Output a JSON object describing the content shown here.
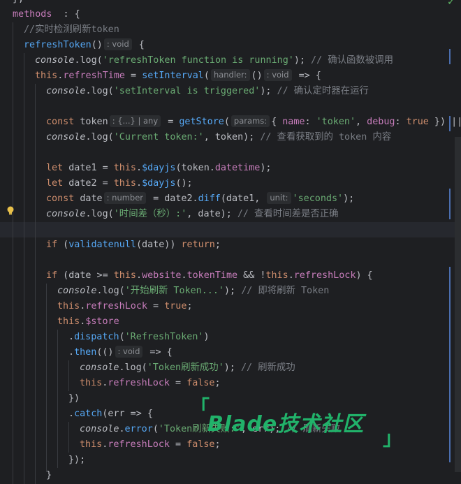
{
  "watermark": {
    "open": "「",
    "text": "Blade技术社区",
    "close": "」"
  },
  "top_fragment": "},",
  "lines": [
    {
      "tokens": [
        [
          "prop",
          "methods"
        ],
        [
          "",
          "  : {"
        ]
      ]
    },
    {
      "tokens": [
        [
          "cm",
          "//实时检测刷新token"
        ]
      ]
    },
    {
      "tokens": [
        [
          "fn",
          "refreshToken"
        ],
        [
          "",
          "()"
        ],
        [
          "hint",
          ": void"
        ],
        [
          "",
          " {"
        ]
      ]
    },
    {
      "tokens": [
        [
          "it",
          "console"
        ],
        [
          "",
          ".log("
        ],
        [
          "str",
          "'refreshToken function is running'"
        ],
        [
          "",
          "); "
        ],
        [
          "cm",
          "// 确认函数被调用"
        ]
      ]
    },
    {
      "tokens": [
        [
          "kw",
          "this"
        ],
        [
          "",
          "."
        ],
        [
          "prop",
          "refreshTime"
        ],
        [
          "",
          " = "
        ],
        [
          "fn",
          "setInterval"
        ],
        [
          "",
          "("
        ],
        [
          "hint",
          "handler:"
        ],
        [
          "",
          "()"
        ],
        [
          "hint",
          ": void"
        ],
        [
          "",
          " => {"
        ]
      ]
    },
    {
      "tokens": [
        [
          "it",
          "console"
        ],
        [
          "",
          ".log("
        ],
        [
          "str",
          "'setInterval is triggered'"
        ],
        [
          "",
          "); "
        ],
        [
          "cm",
          "// 确认定时器在运行"
        ]
      ]
    },
    {
      "tokens": []
    },
    {
      "tokens": [
        [
          "kw",
          "const"
        ],
        [
          "",
          " token"
        ],
        [
          "hint",
          ": {...} | any"
        ],
        [
          "",
          " = "
        ],
        [
          "fn",
          "getStore"
        ],
        [
          "",
          "("
        ],
        [
          "hint",
          "params:"
        ],
        [
          "",
          "{ "
        ],
        [
          "prop",
          "name"
        ],
        [
          "",
          ": "
        ],
        [
          "str",
          "'token'"
        ],
        [
          "",
          ", "
        ],
        [
          "prop",
          "debug"
        ],
        [
          "",
          ": "
        ],
        [
          "kw",
          "true"
        ],
        [
          "",
          " }) ||"
        ]
      ]
    },
    {
      "tokens": [
        [
          "it",
          "console"
        ],
        [
          "",
          ".log("
        ],
        [
          "str",
          "'Current token:'"
        ],
        [
          "",
          ", token); "
        ],
        [
          "cm",
          "// 查看获取到的 token 内容"
        ]
      ]
    },
    {
      "tokens": []
    },
    {
      "tokens": [
        [
          "kw",
          "let"
        ],
        [
          "",
          " date1 = "
        ],
        [
          "kw",
          "this"
        ],
        [
          "",
          "."
        ],
        [
          "fn",
          "$dayjs"
        ],
        [
          "",
          "(token."
        ],
        [
          "prop",
          "datetime"
        ],
        [
          "",
          ");"
        ]
      ]
    },
    {
      "tokens": [
        [
          "kw",
          "let"
        ],
        [
          "",
          " date2 = "
        ],
        [
          "kw",
          "this"
        ],
        [
          "",
          "."
        ],
        [
          "fn",
          "$dayjs"
        ],
        [
          "",
          "();"
        ]
      ]
    },
    {
      "tokens": [
        [
          "kw",
          "const"
        ],
        [
          "",
          " date"
        ],
        [
          "hint",
          ": number"
        ],
        [
          "",
          " = date2."
        ],
        [
          "fn",
          "diff"
        ],
        [
          "",
          "(date1, "
        ],
        [
          "hint",
          "unit:"
        ],
        [
          "str",
          "'seconds'"
        ],
        [
          "",
          ");"
        ]
      ]
    },
    {
      "tokens": [
        [
          "it",
          "console"
        ],
        [
          "",
          ".log("
        ],
        [
          "str",
          "'时间差（秒）:'"
        ],
        [
          "",
          ", date); "
        ],
        [
          "cm",
          "// 查看时间差是否正确"
        ]
      ]
    },
    {
      "tokens": []
    },
    {
      "tokens": [
        [
          "kw",
          "if"
        ],
        [
          "",
          " ("
        ],
        [
          "fn",
          "validatenull"
        ],
        [
          "",
          "(date)) "
        ],
        [
          "kw",
          "return"
        ],
        [
          "",
          ";"
        ]
      ]
    },
    {
      "tokens": []
    },
    {
      "tokens": [
        [
          "kw",
          "if"
        ],
        [
          "",
          " (date >= "
        ],
        [
          "kw",
          "this"
        ],
        [
          "",
          "."
        ],
        [
          "prop",
          "website"
        ],
        [
          "",
          "."
        ],
        [
          "prop",
          "tokenTime"
        ],
        [
          "",
          " && !"
        ],
        [
          "kw",
          "this"
        ],
        [
          "",
          "."
        ],
        [
          "prop",
          "refreshLock"
        ],
        [
          "",
          ") {"
        ]
      ]
    },
    {
      "tokens": [
        [
          "it",
          "console"
        ],
        [
          "",
          ".log("
        ],
        [
          "str",
          "'开始刷新 Token...'"
        ],
        [
          "",
          "); "
        ],
        [
          "cm",
          "// 即将刷新 Token"
        ]
      ]
    },
    {
      "tokens": [
        [
          "kw",
          "this"
        ],
        [
          "",
          "."
        ],
        [
          "prop",
          "refreshLock"
        ],
        [
          "",
          " = "
        ],
        [
          "kw",
          "true"
        ],
        [
          "",
          ";"
        ]
      ]
    },
    {
      "tokens": [
        [
          "kw",
          "this"
        ],
        [
          "",
          "."
        ],
        [
          "prop",
          "$store"
        ]
      ]
    },
    {
      "tokens": [
        [
          "",
          "."
        ],
        [
          "fn",
          "dispatch"
        ],
        [
          "",
          "("
        ],
        [
          "str",
          "'RefreshToken'"
        ],
        [
          "",
          ")"
        ]
      ]
    },
    {
      "tokens": [
        [
          "",
          "."
        ],
        [
          "fn",
          "then"
        ],
        [
          "",
          "(()"
        ],
        [
          "hint",
          ": void"
        ],
        [
          "",
          " => {"
        ]
      ]
    },
    {
      "tokens": [
        [
          "it",
          "console"
        ],
        [
          "",
          ".log("
        ],
        [
          "str",
          "'Token刷新成功'"
        ],
        [
          "",
          "); "
        ],
        [
          "cm",
          "// 刷新成功"
        ]
      ]
    },
    {
      "tokens": [
        [
          "kw",
          "this"
        ],
        [
          "",
          "."
        ],
        [
          "prop",
          "refreshLock"
        ],
        [
          "",
          " = "
        ],
        [
          "kw",
          "false"
        ],
        [
          "",
          ";"
        ]
      ]
    },
    {
      "tokens": [
        [
          "",
          "})"
        ]
      ]
    },
    {
      "tokens": [
        [
          "",
          "."
        ],
        [
          "fn",
          "catch"
        ],
        [
          "",
          "(err => {"
        ]
      ]
    },
    {
      "tokens": [
        [
          "it",
          "console"
        ],
        [
          "",
          "."
        ],
        [
          "fn",
          "error"
        ],
        [
          "",
          "("
        ],
        [
          "str",
          "'Token刷新失败:'"
        ],
        [
          "",
          ", err); "
        ],
        [
          "cm",
          "// 刷新失败"
        ]
      ]
    },
    {
      "tokens": [
        [
          "kw",
          "this"
        ],
        [
          "",
          "."
        ],
        [
          "prop",
          "refreshLock"
        ],
        [
          "",
          " = "
        ],
        [
          "kw",
          "false"
        ],
        [
          "",
          ";"
        ]
      ]
    },
    {
      "tokens": [
        [
          "",
          "});"
        ]
      ]
    },
    {
      "tokens": [
        [
          "",
          "}"
        ]
      ]
    }
  ]
}
